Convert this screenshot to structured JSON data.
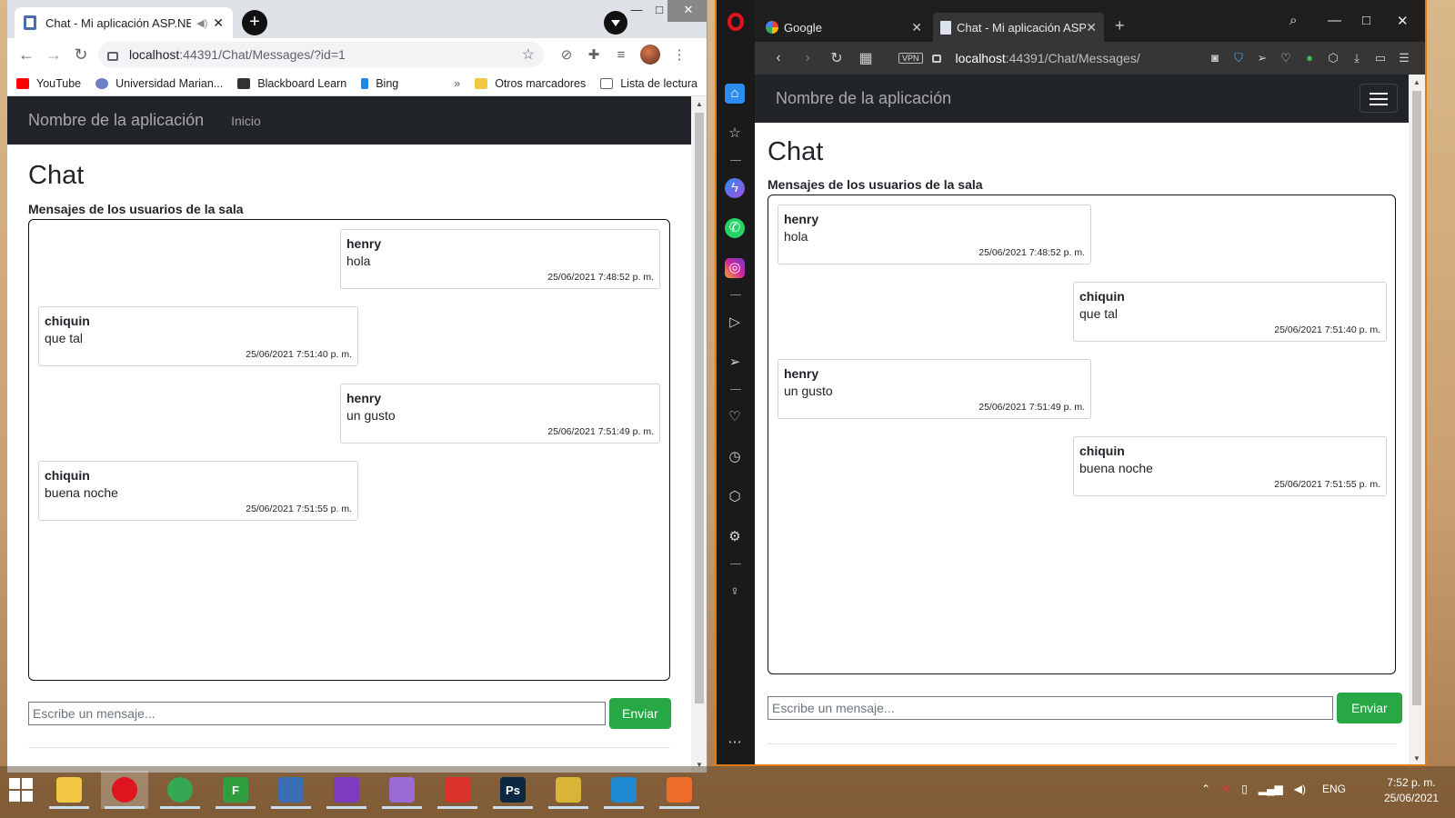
{
  "chrome": {
    "tab_title": "Chat - Mi aplicación ASP.NET",
    "url_host": "localhost",
    "url_path": ":44391/Chat/Messages/?id=1",
    "bookmarks": [
      {
        "label": "YouTube",
        "color": "#ff0000"
      },
      {
        "label": "Universidad Marian...",
        "color": "#6b7fc4"
      },
      {
        "label": "Blackboard Learn",
        "color": "#333333"
      },
      {
        "label": "Bing",
        "color": "#1e88e5"
      }
    ],
    "bookmarks_more": "»",
    "other_bookmarks": "Otros marcadores",
    "reading_list": "Lista de lectura",
    "app": {
      "brand": "Nombre de la aplicación",
      "nav_link": "Inicio",
      "heading": "Chat",
      "subheading": "Mensajes de los usuarios de la sala",
      "messages": [
        {
          "user": "henry",
          "text": "hola",
          "time": "25/06/2021 7:48:52 p. m.",
          "side": "right"
        },
        {
          "user": "chiquin",
          "text": "que tal",
          "time": "25/06/2021 7:51:40 p. m.",
          "side": "left"
        },
        {
          "user": "henry",
          "text": "un gusto",
          "time": "25/06/2021 7:51:49 p. m.",
          "side": "right"
        },
        {
          "user": "chiquin",
          "text": "buena noche",
          "time": "25/06/2021 7:51:55 p. m.",
          "side": "left"
        }
      ],
      "input_placeholder": "Escribe un mensaje...",
      "send_label": "Enviar"
    }
  },
  "opera": {
    "tabs": [
      {
        "title": "Google",
        "active": false
      },
      {
        "title": "Chat - Mi aplicación ASP.N",
        "active": true
      }
    ],
    "vpn_label": "VPN",
    "url_host": "localhost",
    "url_path": ":44391/Chat/Messages/",
    "app": {
      "brand": "Nombre de la aplicación",
      "heading": "Chat",
      "subheading": "Mensajes de los usuarios de la sala",
      "messages": [
        {
          "user": "henry",
          "text": "hola",
          "time": "25/06/2021 7:48:52 p. m.",
          "side": "left"
        },
        {
          "user": "chiquin",
          "text": "que tal",
          "time": "25/06/2021 7:51:40 p. m.",
          "side": "right"
        },
        {
          "user": "henry",
          "text": "un gusto",
          "time": "25/06/2021 7:51:49 p. m.",
          "side": "left"
        },
        {
          "user": "chiquin",
          "text": "buena noche",
          "time": "25/06/2021 7:51:55 p. m.",
          "side": "right"
        }
      ],
      "input_placeholder": "Escribe un mensaje...",
      "send_label": "Enviar"
    }
  },
  "taskbar": {
    "language": "ENG",
    "time": "7:52 p. m.",
    "date": "25/06/2021",
    "apps": [
      {
        "name": "file-explorer",
        "color": "#f2c744"
      },
      {
        "name": "opera",
        "color": "#e0141e",
        "active": true
      },
      {
        "name": "chrome",
        "color": "#34a853"
      },
      {
        "name": "freeplane",
        "color": "#2e9e3e",
        "glyph": "F"
      },
      {
        "name": "eclipse",
        "color": "#3a6fb5"
      },
      {
        "name": "visual-studio",
        "color": "#7d3bc1"
      },
      {
        "name": "visual-studio-preview",
        "color": "#9b6ad6"
      },
      {
        "name": "sketchup",
        "color": "#d9332b"
      },
      {
        "name": "photoshop",
        "color": "#0b2742",
        "glyph": "Ps"
      },
      {
        "name": "paint-tool",
        "color": "#d8b437"
      },
      {
        "name": "vscode",
        "color": "#1f8ad2"
      },
      {
        "name": "postman",
        "color": "#ef6c2b"
      }
    ]
  }
}
